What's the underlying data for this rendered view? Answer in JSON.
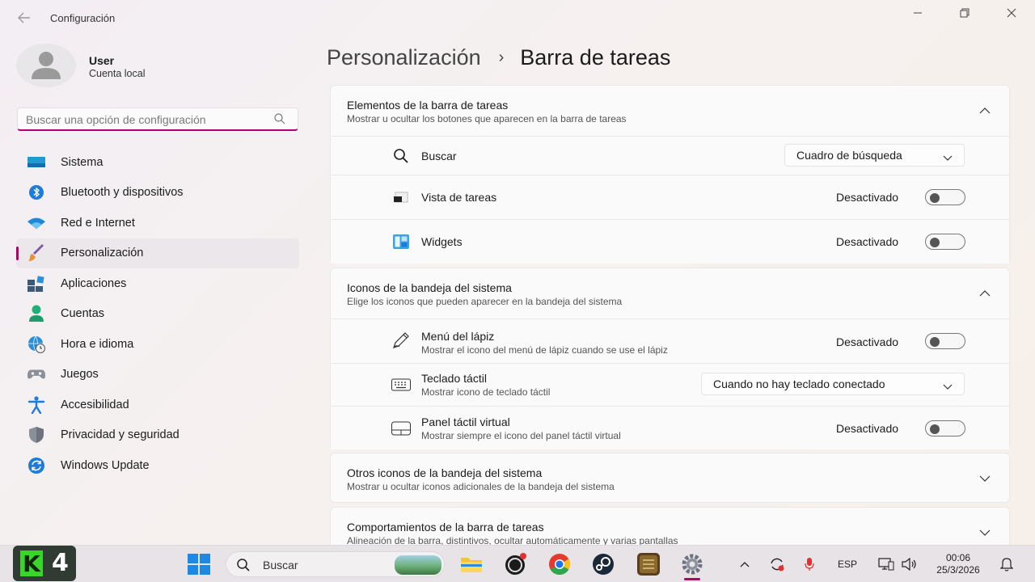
{
  "window": {
    "app_title": "Configuración"
  },
  "user": {
    "name": "User",
    "account": "Cuenta local"
  },
  "search": {
    "placeholder": "Buscar una opción de configuración"
  },
  "nav": {
    "items": [
      {
        "label": "Sistema",
        "icon": "monitor-icon"
      },
      {
        "label": "Bluetooth y dispositivos",
        "icon": "bluetooth-icon"
      },
      {
        "label": "Red e Internet",
        "icon": "wifi-icon"
      },
      {
        "label": "Personalización",
        "icon": "brush-icon",
        "active": true
      },
      {
        "label": "Aplicaciones",
        "icon": "apps-icon"
      },
      {
        "label": "Cuentas",
        "icon": "person-icon"
      },
      {
        "label": "Hora e idioma",
        "icon": "globe-clock-icon"
      },
      {
        "label": "Juegos",
        "icon": "gamepad-icon"
      },
      {
        "label": "Accesibilidad",
        "icon": "accessibility-icon"
      },
      {
        "label": "Privacidad y seguridad",
        "icon": "shield-icon"
      },
      {
        "label": "Windows Update",
        "icon": "update-icon"
      }
    ]
  },
  "breadcrumb": {
    "parent": "Personalización",
    "separator": "›",
    "current": "Barra de tareas"
  },
  "sections": {
    "taskbar_items": {
      "title": "Elementos de la barra de tareas",
      "subtitle": "Mostrar u ocultar los botones que aparecen en la barra de tareas",
      "expanded": true,
      "rows": [
        {
          "title": "Buscar",
          "icon": "search-icon",
          "control": "dropdown",
          "value": "Cuadro de búsqueda"
        },
        {
          "title": "Vista de tareas",
          "icon": "task-view-icon",
          "control": "toggle",
          "state": "Desactivado",
          "on": false
        },
        {
          "title": "Widgets",
          "icon": "widgets-icon",
          "control": "toggle",
          "state": "Desactivado",
          "on": false
        }
      ]
    },
    "tray_icons": {
      "title": "Iconos de la bandeja del sistema",
      "subtitle": "Elige los iconos que pueden aparecer en la bandeja del sistema",
      "expanded": true,
      "rows": [
        {
          "title": "Menú del lápiz",
          "subtitle": "Mostrar el icono del menú de lápiz cuando se use el lápiz",
          "icon": "pen-icon",
          "control": "toggle",
          "state": "Desactivado",
          "on": false
        },
        {
          "title": "Teclado táctil",
          "subtitle": "Mostrar icono de teclado táctil",
          "icon": "keyboard-icon",
          "control": "dropdown",
          "value": "Cuando no hay teclado conectado"
        },
        {
          "title": "Panel táctil virtual",
          "subtitle": "Mostrar siempre el icono del panel táctil virtual",
          "icon": "touchpad-icon",
          "control": "toggle",
          "state": "Desactivado",
          "on": false
        }
      ]
    },
    "other_tray": {
      "title": "Otros iconos de la bandeja del sistema",
      "subtitle": "Mostrar u ocultar iconos adicionales de la bandeja del sistema",
      "expanded": false
    },
    "behaviors": {
      "title": "Comportamientos de la barra de tareas",
      "subtitle": "Alineación de la barra, distintivos, ocultar automáticamente y varias pantallas",
      "expanded": false
    }
  },
  "taskbar": {
    "search_label": "Buscar",
    "language": "ESP",
    "time": "00:06",
    "date": "25/3/2026",
    "overlay_logo_letter": "K",
    "overlay_logo_number": "4",
    "apps": [
      "file-explorer-icon",
      "obs-icon",
      "chrome-icon",
      "steam-icon",
      "game-icon",
      "settings-icon"
    ],
    "colors": {
      "accent": "#b4006b"
    }
  }
}
